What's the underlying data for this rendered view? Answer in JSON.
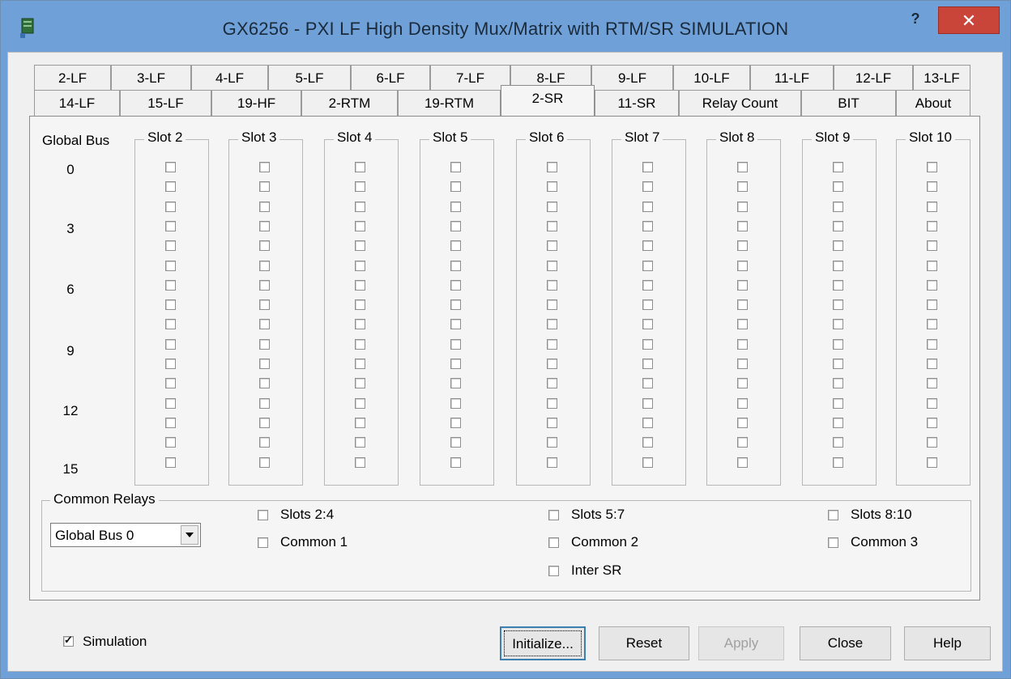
{
  "window": {
    "title": "GX6256 - PXI LF High Density Mux/Matrix with RTM/SR SIMULATION",
    "help": "?",
    "close": "✕"
  },
  "tabs_row1": [
    "2-LF",
    "3-LF",
    "4-LF",
    "5-LF",
    "6-LF",
    "7-LF",
    "8-LF",
    "9-LF",
    "10-LF",
    "11-LF",
    "12-LF",
    "13-LF"
  ],
  "tabs_row2": [
    "14-LF",
    "15-LF",
    "19-HF",
    "2-RTM",
    "19-RTM",
    "2-SR",
    "11-SR",
    "Relay Count",
    "BIT",
    "About"
  ],
  "active_tab": "2-SR",
  "global_bus": {
    "title": "Global Bus",
    "numbers": [
      "0",
      "3",
      "6",
      "9",
      "12",
      "15"
    ]
  },
  "slots": [
    "Slot 2",
    "Slot 3",
    "Slot 4",
    "Slot 5",
    "Slot 6",
    "Slot 7",
    "Slot 8",
    "Slot 9",
    "Slot 10"
  ],
  "relays_per_slot": 16,
  "common_relays": {
    "title": "Common Relays",
    "bus_select": "Global Bus 0",
    "items": [
      {
        "label": "Slots 2:4",
        "checked": false
      },
      {
        "label": "Common 1",
        "checked": false
      },
      {
        "label": "Slots 5:7",
        "checked": false
      },
      {
        "label": "Common 2",
        "checked": false
      },
      {
        "label": "Inter SR",
        "checked": false
      },
      {
        "label": "Slots 8:10",
        "checked": false
      },
      {
        "label": "Common 3",
        "checked": false
      }
    ]
  },
  "simulation": {
    "label": "Simulation",
    "checked": true
  },
  "buttons": {
    "initialize": "Initialize...",
    "reset": "Reset",
    "apply": "Apply",
    "close": "Close",
    "help": "Help"
  }
}
